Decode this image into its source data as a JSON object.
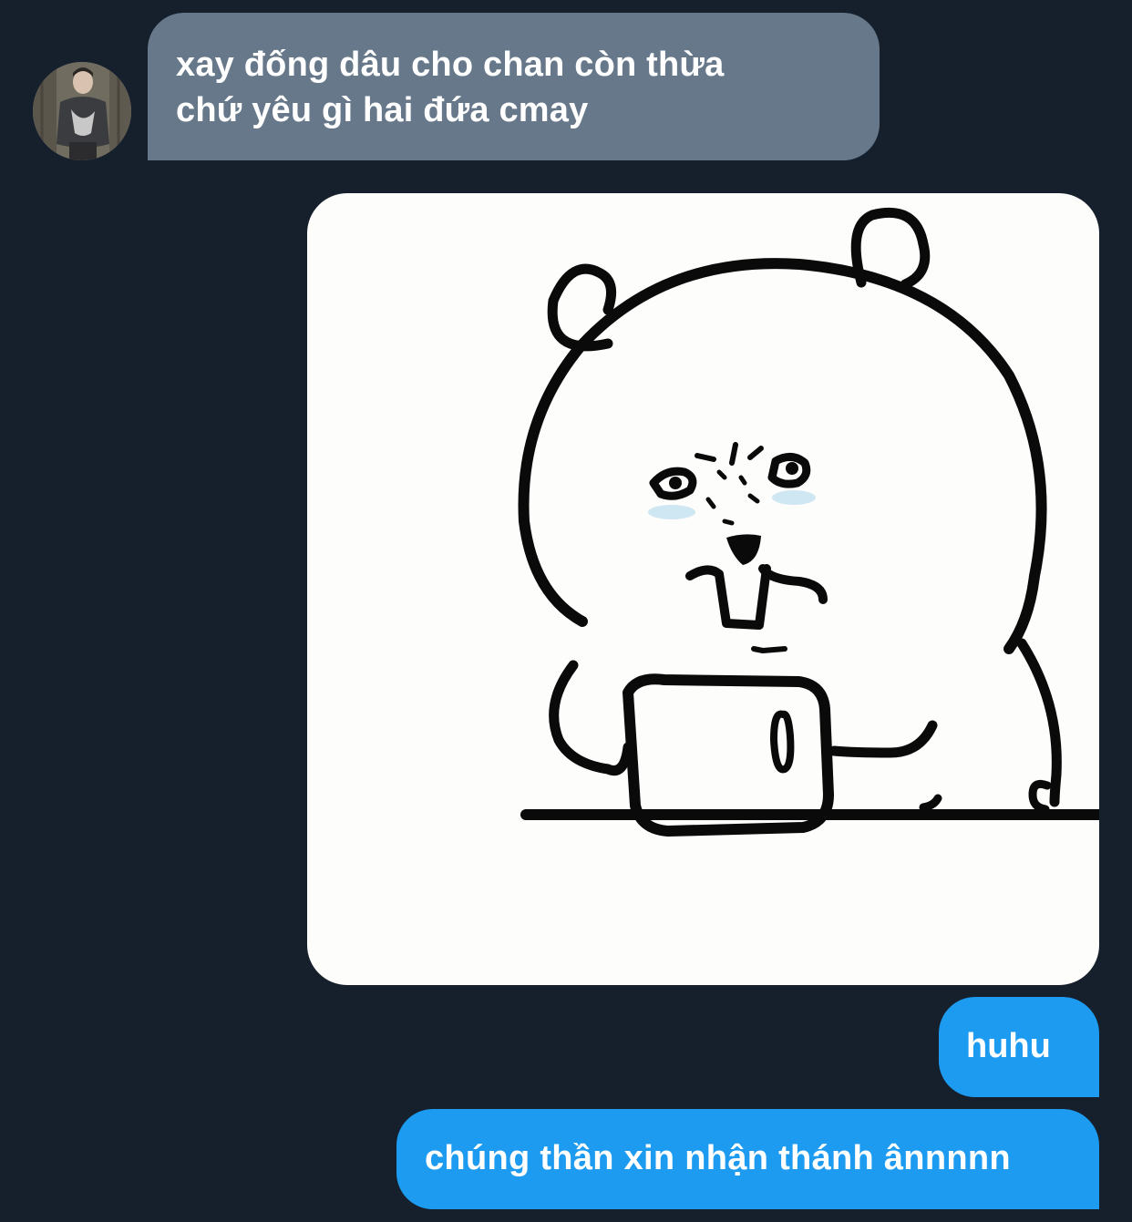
{
  "conversation": {
    "incoming": {
      "lines": [
        "xay đống dâu cho chan còn thừa",
        "chứ yêu gì hai đứa cmay"
      ],
      "color": "#66788a"
    },
    "sticker": {
      "icon": "crying-bear-sticker",
      "background": "#fdfdfb"
    },
    "outgoing": [
      {
        "text": "huhu"
      },
      {
        "text": "chúng thần xin nhận thánh ânnnnn"
      }
    ],
    "outgoing_color": "#1d9bf0",
    "background": "#16202c"
  }
}
